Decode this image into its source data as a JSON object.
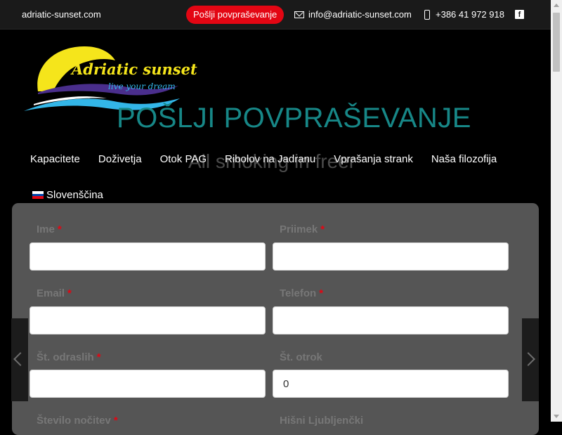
{
  "topbar": {
    "site": "adriatic-sunset.com",
    "cta": "Pošlji povpraševanje",
    "email": "info@adriatic-sunset.com",
    "phone": "+386 41 972 918",
    "facebook": "f"
  },
  "logo": {
    "title": "Adriatic sunset",
    "tagline": "live your dream"
  },
  "page": {
    "title": "POŠLJI POVPRAŠEVANJE",
    "ghost_subtitle": "All smoking in freer"
  },
  "nav": {
    "items": [
      {
        "label": "Kapacitete"
      },
      {
        "label": "Doživetja"
      },
      {
        "label": "Otok PAG"
      },
      {
        "label": "Ribolov na Jadranu"
      },
      {
        "label": "Vprašanja strank"
      },
      {
        "label": "Naša filozofija"
      }
    ],
    "language": "Slovenščina"
  },
  "form": {
    "required_mark": "*",
    "first_name": {
      "label": "Ime",
      "value": ""
    },
    "last_name": {
      "label": "Priimek",
      "value": ""
    },
    "email": {
      "label": "Email",
      "value": ""
    },
    "phone": {
      "label": "Telefon",
      "value": ""
    },
    "adults": {
      "label": "Št. odraslih",
      "value": ""
    },
    "children": {
      "label": "Št. otrok",
      "value": "0"
    },
    "nights": {
      "label": "Število nočitev"
    },
    "extra": {
      "label": "Hišni Ljubljenčki"
    }
  },
  "colors": {
    "accent_red": "#e30613",
    "title_teal": "#178787",
    "panel_bg": "#555555",
    "logo_yellow": "#f5e51b",
    "logo_blue": "#33b6e8"
  }
}
